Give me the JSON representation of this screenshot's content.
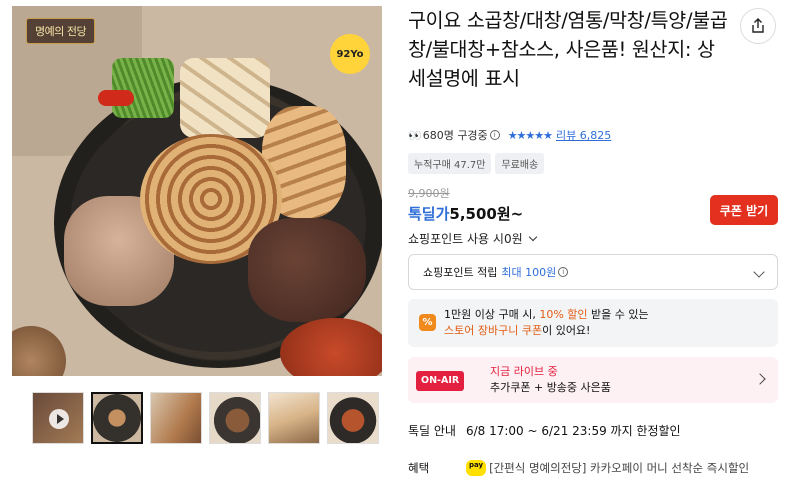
{
  "image": {
    "corner_label": "명예의 전당",
    "brand_badge": "92Yo"
  },
  "thumbnails": [
    {
      "name": "thumb-video",
      "is_video": true
    },
    {
      "name": "thumb-2",
      "active": true
    },
    {
      "name": "thumb-3"
    },
    {
      "name": "thumb-4"
    },
    {
      "name": "thumb-5"
    },
    {
      "name": "thumb-6"
    }
  ],
  "product": {
    "title": "구이요 소곱창/대창/염통/막창/특양/불곱창/불대창+참소스, 사은품! 원산지: 상세설명에 표시",
    "viewers": "680명 구경중",
    "stars": "★★★★★",
    "review_link": "리뷰 6,825",
    "chips": [
      "누적구매 47.7만",
      "무료배송"
    ],
    "original_price": "9,900원",
    "deal_label": "톡딜가",
    "deal_price": "5,500원~",
    "coupon_button": "쿠폰 받기",
    "point_use": "쇼핑포인트 사용 시0원",
    "point_save_label": "쇼핑포인트 적립",
    "point_save_value": "최대 100원"
  },
  "promo": {
    "icon": "%",
    "line1_a": "1만원 이상 구매 시, ",
    "line1_b": "10% 할인",
    "line1_c": " 받을 수 있는",
    "line2_a": "스토어 장바구니 쿠폰",
    "line2_b": "이 있어요!"
  },
  "live": {
    "badge": "ON-AIR",
    "title": "지금 라이브 중",
    "subtitle": "추가쿠폰 + 방송중 사은품"
  },
  "deal_info": {
    "label": "톡딜 안내",
    "period": "6/8 17:00 ~ 6/21 23:59 까지 한정할인"
  },
  "benefit": {
    "label": "혜택",
    "pay": "pay",
    "text": "[간편식 명예의전당] 카카오페이 머니 선착순 즉시할인"
  },
  "colors": {
    "accent_blue": "#2f6ed8",
    "coupon_red": "#e3301f",
    "live_red": "#e3203f",
    "promo_orange": "#e35b12"
  }
}
